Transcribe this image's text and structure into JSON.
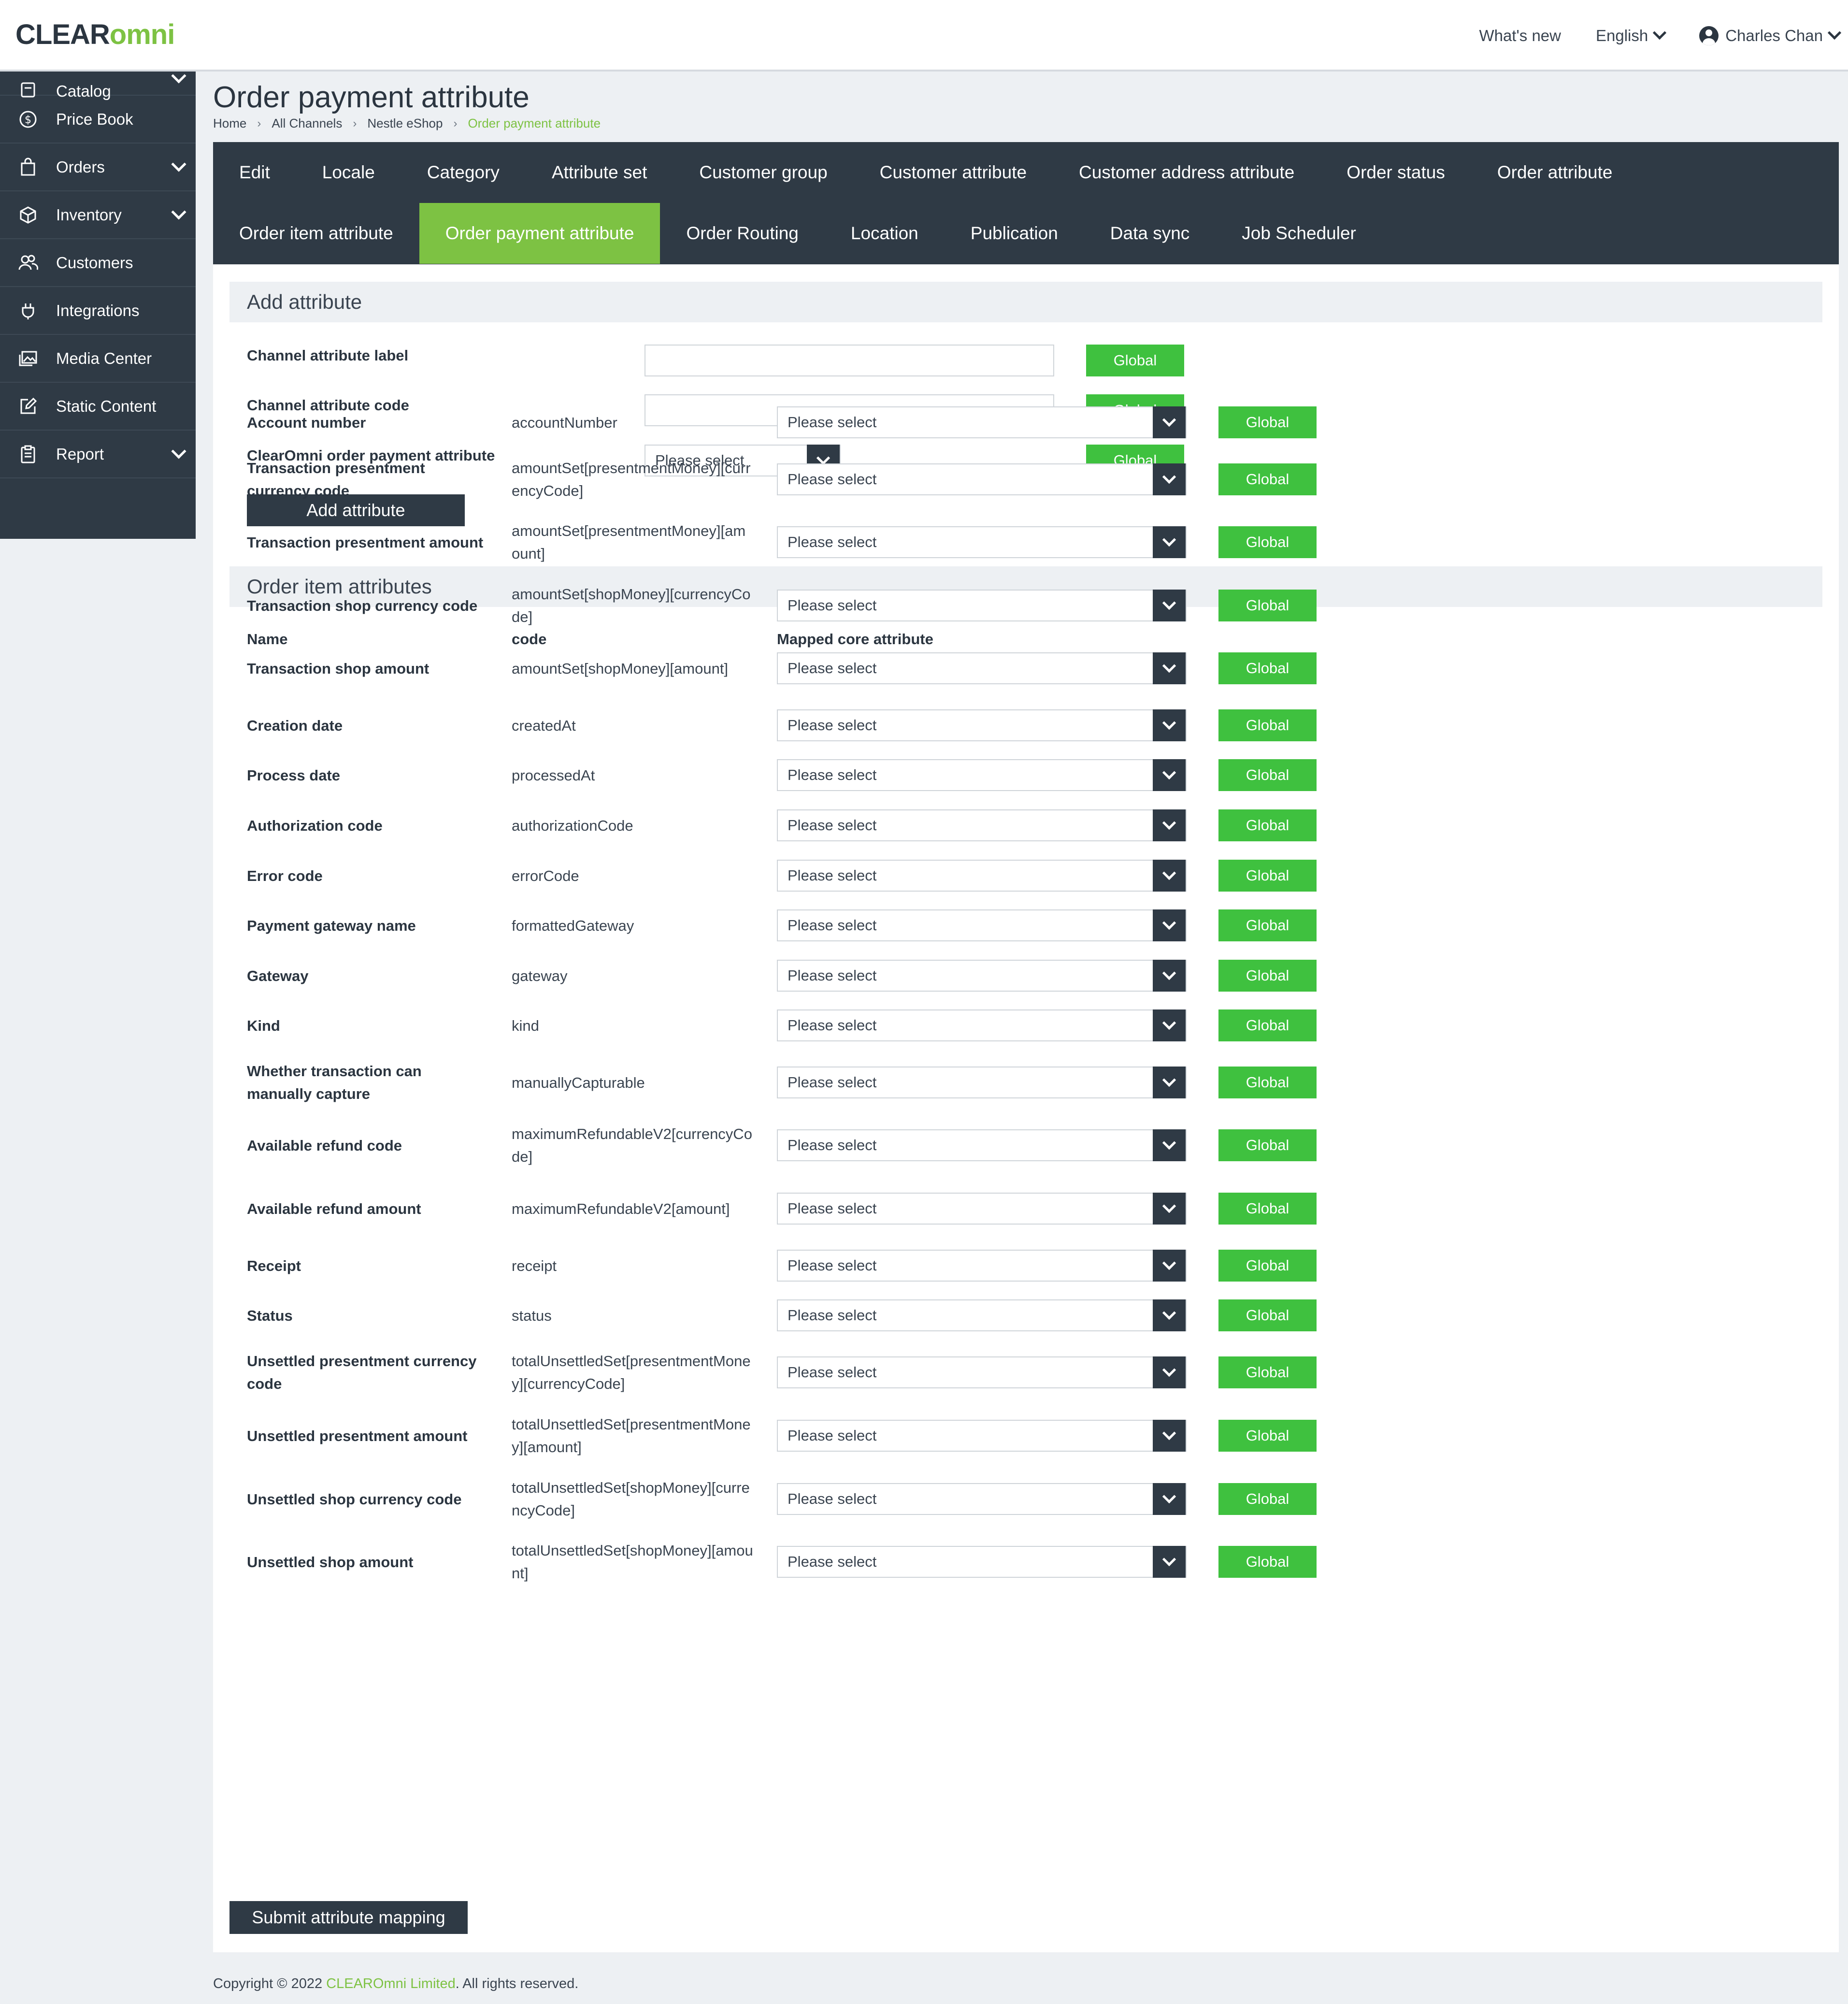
{
  "app": {
    "logo_clear": "CLEAR",
    "logo_omni": "omni",
    "whats_new": "What's new",
    "language": "English",
    "user_name": "Charles Chan"
  },
  "sidebar": {
    "items": [
      {
        "label": "Catalog",
        "icon": "catalog-icon",
        "caret": true
      },
      {
        "label": "Price Book",
        "icon": "dollar-icon",
        "caret": false
      },
      {
        "label": "Orders",
        "icon": "shopping-bag-icon",
        "caret": true
      },
      {
        "label": "Inventory",
        "icon": "box-icon",
        "caret": true
      },
      {
        "label": "Customers",
        "icon": "users-icon",
        "caret": false
      },
      {
        "label": "Integrations",
        "icon": "plug-icon",
        "caret": false
      },
      {
        "label": "Media Center",
        "icon": "images-icon",
        "caret": false
      },
      {
        "label": "Static Content",
        "icon": "edit-icon",
        "caret": false
      },
      {
        "label": "Report",
        "icon": "clipboard-icon",
        "caret": true
      }
    ]
  },
  "page": {
    "title": "Order payment attribute",
    "breadcrumb": [
      "Home",
      "All Channels",
      "Nestle eShop",
      "Order payment attribute"
    ]
  },
  "tabs": {
    "row1": [
      "Edit",
      "Locale",
      "Category",
      "Attribute set",
      "Customer group",
      "Customer attribute",
      "Customer address attribute",
      "Order status",
      "Order attribute"
    ],
    "row2": [
      "Order item attribute",
      "Order payment attribute",
      "Order Routing",
      "Location",
      "Publication",
      "Data sync",
      "Job Scheduler"
    ],
    "active": "Order payment attribute"
  },
  "add_attribute": {
    "heading": "Add attribute",
    "label_field": "Channel attribute label",
    "code_field": "Channel attribute code",
    "core_field": "ClearOmni order payment attribute",
    "select_placeholder": "Please select",
    "global_label": "Global",
    "submit_label": "Add attribute",
    "label_value": "",
    "code_value": ""
  },
  "mapping": {
    "heading": "Order item attributes",
    "columns": {
      "name": "Name",
      "code": "code",
      "mapped": "Mapped core attribute"
    },
    "select_placeholder": "Please select",
    "global_label": "Global",
    "rows": [
      {
        "name": "Account number",
        "code": "accountNumber"
      },
      {
        "name": "Transaction presentment currency code",
        "code": "amountSet[presentmentMoney][currencyCode]"
      },
      {
        "name": "Transaction presentment amount",
        "code": "amountSet[presentmentMoney][amount]"
      },
      {
        "name": "Transaction shop currency code",
        "code": "amountSet[shopMoney][currencyCode]"
      },
      {
        "name": "Transaction shop amount",
        "code": "amountSet[shopMoney][amount]"
      },
      {
        "name": "Creation date",
        "code": "createdAt"
      },
      {
        "name": "Process date",
        "code": "processedAt"
      },
      {
        "name": "Authorization code",
        "code": "authorizationCode"
      },
      {
        "name": "Error code",
        "code": "errorCode"
      },
      {
        "name": "Payment gateway name",
        "code": "formattedGateway"
      },
      {
        "name": "Gateway",
        "code": "gateway"
      },
      {
        "name": "Kind",
        "code": "kind"
      },
      {
        "name": "Whether transaction can manually capture",
        "code": "manuallyCapturable"
      },
      {
        "name": "Available refund code",
        "code": "maximumRefundableV2[currencyCode]"
      },
      {
        "name": "Available refund amount",
        "code": "maximumRefundableV2[amount]"
      },
      {
        "name": "Receipt",
        "code": "receipt"
      },
      {
        "name": "Status",
        "code": "status"
      },
      {
        "name": "Unsettled presentment currency code",
        "code": "totalUnsettledSet[presentmentMoney][currencyCode]"
      },
      {
        "name": "Unsettled presentment amount",
        "code": "totalUnsettledSet[presentmentMoney][amount]"
      },
      {
        "name": "Unsettled shop currency code",
        "code": "totalUnsettledSet[shopMoney][currencyCode]"
      },
      {
        "name": "Unsettled shop amount",
        "code": "totalUnsettledSet[shopMoney][amount]"
      }
    ],
    "submit_label": "Submit attribute mapping"
  },
  "footer": {
    "prefix": "Copyright © 2022 ",
    "brand": "CLEAROmni Limited",
    "suffix": ". All rights reserved."
  },
  "colors": {
    "accent_green": "#7dc243",
    "button_green": "#3fc13f",
    "dark_navy": "#2f3a45"
  }
}
